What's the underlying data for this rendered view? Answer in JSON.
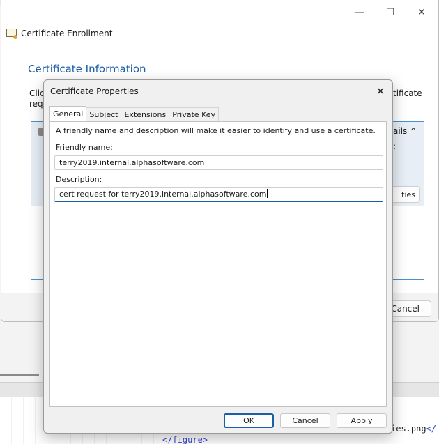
{
  "outer_window": {
    "title": "Certificate Enrollment",
    "heading": "Certificate Information",
    "instruction_left_line1": "Click",
    "instruction_left_line2": "requ",
    "instruction_right": "tificate",
    "details_fragment": "ails",
    "colon_fragment": ":",
    "properties_fragment": "ties",
    "cancel_label": "Cancel",
    "caption": {
      "minimize": "—",
      "maximize": "☐",
      "close": "✕"
    }
  },
  "dialog": {
    "title": "Certificate Properties",
    "close_glyph": "✕",
    "tabs": [
      {
        "label": "General",
        "active": true
      },
      {
        "label": "Subject",
        "active": false
      },
      {
        "label": "Extensions",
        "active": false
      },
      {
        "label": "Private Key",
        "active": false
      }
    ],
    "general": {
      "description": "A friendly name and description will make it easier to identify and use a certificate.",
      "friendly_name_label": "Friendly name:",
      "friendly_name_value": "terry2019.internal.alphasoftware.com",
      "description_label": "Description:",
      "description_value": "cert request for terry2019.internal.alphasoftware.com"
    },
    "buttons": {
      "ok": "OK",
      "cancel": "Cancel",
      "apply": "Apply"
    }
  },
  "background": {
    "code_line1_text": "ies.png",
    "code_line1_tag": "</",
    "code_line2": "</figure>"
  },
  "colors": {
    "accent": "#1a5ea8",
    "panel_border": "#4a8fd0",
    "dialog_bg": "#f0f0f0"
  }
}
